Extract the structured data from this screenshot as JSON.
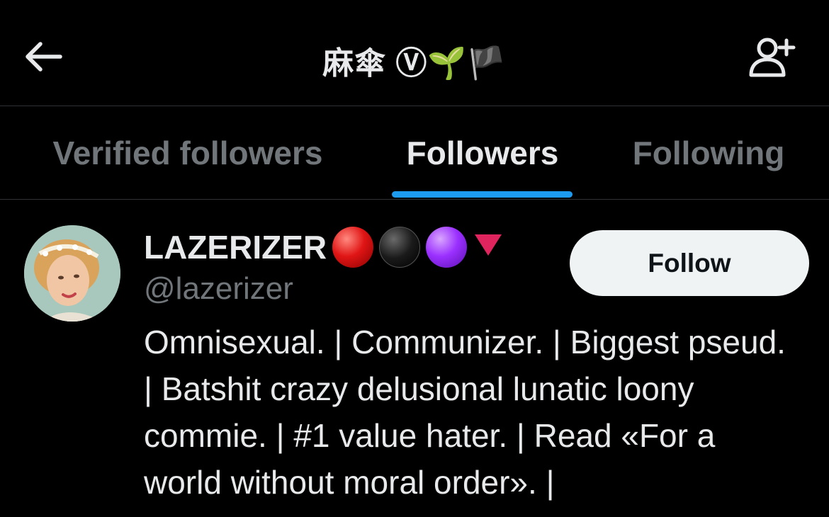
{
  "header": {
    "title": "麻傘 Ⓥ🌱🏴",
    "back_icon": "arrow-left-icon",
    "add_user_icon": "person-plus-icon"
  },
  "tabs": [
    {
      "label": "Verified followers",
      "active": false
    },
    {
      "label": "Followers",
      "active": true
    },
    {
      "label": "Following",
      "active": false
    }
  ],
  "colors": {
    "accent": "#1d9bf0",
    "background": "#000000",
    "text_primary": "#e7e9ea",
    "text_secondary": "#71767b",
    "button_bg": "#eff3f4"
  },
  "user": {
    "display_name": "LAZERIZER",
    "name_emojis": [
      "red-circle",
      "black-circle",
      "purple-circle",
      "red-down-triangle"
    ],
    "handle": "@lazerizer",
    "follow_label": "Follow",
    "bio": "Omnisexual. | Communizer. | Biggest pseud. | Batshit crazy delusional lunatic loony commie. | #1 value hater. | Read «For a world without moral order». |"
  }
}
